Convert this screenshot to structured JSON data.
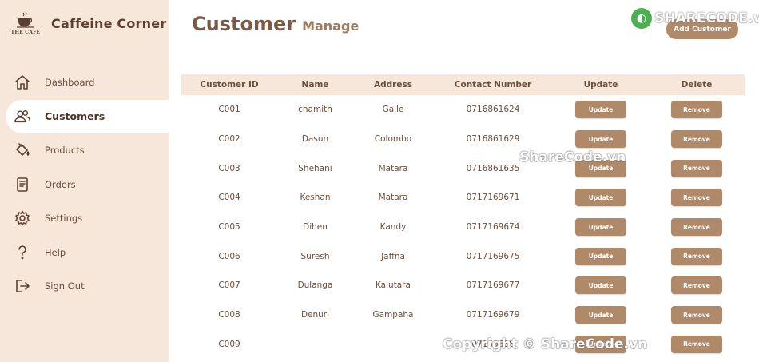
{
  "app": {
    "name": "Caffeine Corner",
    "logo_text": "THE CAFE"
  },
  "sidebar": {
    "items": [
      {
        "label": "Dashboard",
        "icon": "home-icon"
      },
      {
        "label": "Customers",
        "icon": "users-icon",
        "active": true
      },
      {
        "label": "Products",
        "icon": "paint-bucket-icon"
      },
      {
        "label": "Orders",
        "icon": "document-icon"
      },
      {
        "label": "Settings",
        "icon": "gear-icon"
      },
      {
        "label": "Help",
        "icon": "question-icon"
      },
      {
        "label": "Sign Out",
        "icon": "sign-out-icon"
      }
    ]
  },
  "header": {
    "title": "Customer",
    "subtitle": "Manage",
    "add_button": "Add Customer"
  },
  "watermarks": {
    "top": "SHARECODE.vn",
    "center": "ShareCode.vn",
    "bottom": "Copyright © ShareCode.vn"
  },
  "table": {
    "columns": [
      "Customer ID",
      "Name",
      "Address",
      "Contact Number",
      "Update",
      "Delete"
    ],
    "update_label": "Update",
    "remove_label": "Remove",
    "rows": [
      {
        "id": "C001",
        "name": "chamith",
        "address": "Galle",
        "contact": "0716861624"
      },
      {
        "id": "C002",
        "name": "Dasun",
        "address": "Colombo",
        "contact": "0716861629"
      },
      {
        "id": "C003",
        "name": "Shehani",
        "address": "Matara",
        "contact": "0716861635"
      },
      {
        "id": "C004",
        "name": "Keshan",
        "address": "Matara",
        "contact": "0717169671"
      },
      {
        "id": "C005",
        "name": "Dihen",
        "address": "Kandy",
        "contact": "0717169674"
      },
      {
        "id": "C006",
        "name": "Suresh",
        "address": "Jaffna",
        "contact": "0717169675"
      },
      {
        "id": "C007",
        "name": "Dulanga",
        "address": "Kalutara",
        "contact": "0717169677"
      },
      {
        "id": "C008",
        "name": "Denuri",
        "address": "Gampaha",
        "contact": "0717169679"
      },
      {
        "id": "C009",
        "name": "",
        "address": "",
        "contact": "07169688"
      }
    ]
  },
  "colors": {
    "sidebar_bg": "#f7e6da",
    "accent": "#b08968",
    "text": "#6b4f3a"
  }
}
